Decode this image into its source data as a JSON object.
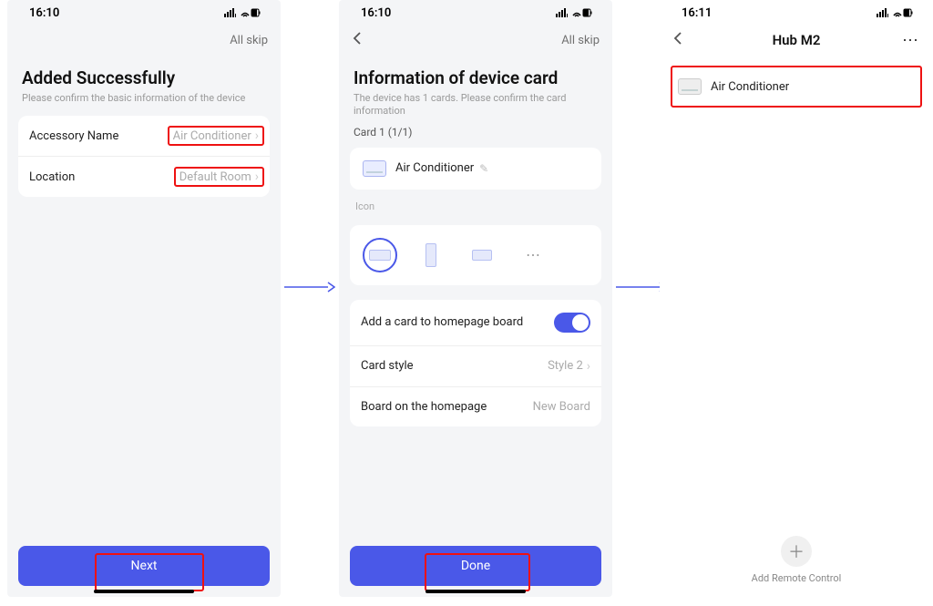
{
  "screen1": {
    "time": "16:10",
    "skip": "All skip",
    "title": "Added Successfully",
    "subtitle": "Please confirm the basic information of the device",
    "rows": {
      "name_label": "Accessory Name",
      "name_value": "Air Conditioner",
      "loc_label": "Location",
      "loc_value": "Default Room"
    },
    "button": "Next"
  },
  "screen2": {
    "time": "16:10",
    "skip": "All skip",
    "title": "Information of device card",
    "subtitle": "The device has 1 cards. Please confirm the card information",
    "card_num": "Card 1 (1/1)",
    "device_name": "Air Conditioner",
    "icon_label": "Icon",
    "settings": {
      "add_card": "Add a card to homepage board",
      "style_label": "Card style",
      "style_value": "Style 2",
      "board_label": "Board on the homepage",
      "board_value": "New Board"
    },
    "button": "Done"
  },
  "screen3": {
    "time": "16:11",
    "title": "Hub M2",
    "device": "Air Conditioner",
    "add_remote": "Add Remote Control"
  },
  "colors": {
    "accent": "#4a58e8",
    "highlight": "#e11"
  }
}
